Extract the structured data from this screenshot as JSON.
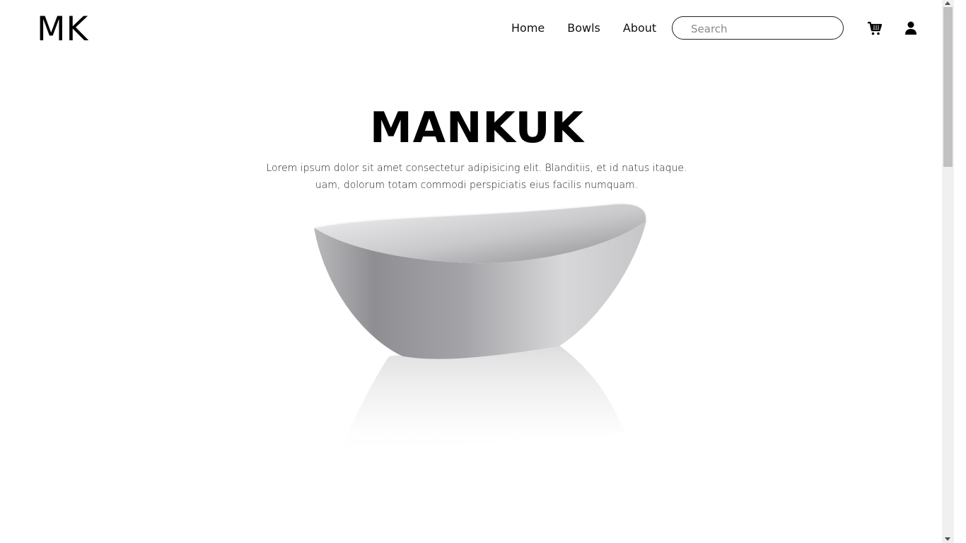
{
  "header": {
    "logo": "MK",
    "nav": {
      "home": "Home",
      "bowls": "Bowls",
      "about": "About"
    },
    "search": {
      "placeholder": "Search",
      "value": ""
    },
    "icons": {
      "cart": "cart-icon",
      "user": "user-icon"
    }
  },
  "hero": {
    "title": "MANKUK",
    "description_line1": "Lorem ipsum dolor sit amet consectetur adipisicing elit. Blanditiis, et id natus itaque.",
    "description_line2": "uam, dolorum totam commodi perspiciatis eius facilis numquam.",
    "image": "white-bowl"
  },
  "colors": {
    "text": "#000000",
    "background": "#ffffff",
    "bowl_light": "#e6e6e8",
    "bowl_dark": "#8e8e92"
  }
}
